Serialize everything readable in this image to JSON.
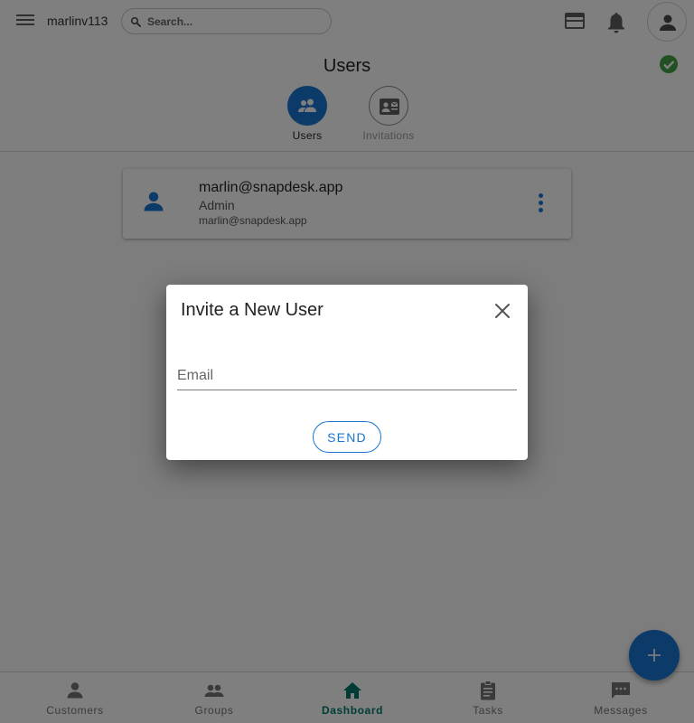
{
  "topbar": {
    "username": "marlinv113",
    "search_placeholder": "Search..."
  },
  "header": {
    "title": "Users",
    "tabs": [
      {
        "label": "Users",
        "icon": "people-icon",
        "active": true
      },
      {
        "label": "Invitations",
        "icon": "contact-mail-icon",
        "active": false
      }
    ]
  },
  "user_list": [
    {
      "name": "marlin@snapdesk.app",
      "role": "Admin",
      "email": "marlin@snapdesk.app"
    }
  ],
  "dialog": {
    "title": "Invite a New User",
    "email_placeholder": "Email",
    "email_value": "",
    "send_label": "SEND"
  },
  "bottom_nav": [
    {
      "label": "Customers",
      "icon": "person-icon",
      "active": false
    },
    {
      "label": "Groups",
      "icon": "people-icon",
      "active": false
    },
    {
      "label": "Dashboard",
      "icon": "home-icon",
      "active": true
    },
    {
      "label": "Tasks",
      "icon": "clipboard-icon",
      "active": false
    },
    {
      "label": "Messages",
      "icon": "chat-icon",
      "active": false
    }
  ],
  "colors": {
    "primary": "#1976d2",
    "active_nav": "#00796b",
    "status_ok": "#43a047",
    "overlay": "rgba(0,0,0,0.5)"
  }
}
